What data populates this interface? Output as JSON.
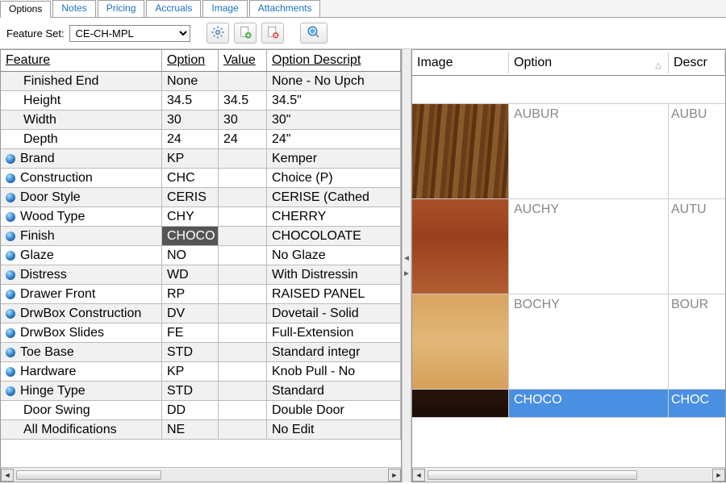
{
  "tabs": [
    "Options",
    "Notes",
    "Pricing",
    "Accruals",
    "Image",
    "Attachments"
  ],
  "activeTab": 0,
  "toolbar": {
    "featureSetLabel": "Feature Set:",
    "featureSetValue": "CE-CH-MPL"
  },
  "leftGrid": {
    "headers": {
      "feature": "Feature",
      "option": "Option",
      "value": "Value",
      "desc": "Option Descript"
    },
    "rows": [
      {
        "feature": "Finished End",
        "option": "None",
        "value": "",
        "desc": "None - No Upch",
        "indent": true,
        "globe": false
      },
      {
        "feature": "Height",
        "option": "34.5",
        "value": "34.5",
        "desc": "34.5\"",
        "indent": true,
        "globe": false
      },
      {
        "feature": "Width",
        "option": "30",
        "value": "30",
        "desc": "30\"",
        "indent": true,
        "globe": false
      },
      {
        "feature": "Depth",
        "option": "24",
        "value": "24",
        "desc": "24\"",
        "indent": true,
        "globe": false
      },
      {
        "feature": "Brand",
        "option": "KP",
        "value": "",
        "desc": "Kemper",
        "indent": false,
        "globe": true
      },
      {
        "feature": "Construction",
        "option": "CHC",
        "value": "",
        "desc": "Choice (P)",
        "indent": false,
        "globe": true
      },
      {
        "feature": "Door Style",
        "option": "CERIS",
        "value": "",
        "desc": "CERISE (Cathed",
        "indent": false,
        "globe": true
      },
      {
        "feature": "Wood Type",
        "option": "CHY",
        "value": "",
        "desc": "CHERRY",
        "indent": false,
        "globe": true
      },
      {
        "feature": "Finish",
        "option": "CHOCO",
        "value": "",
        "desc": "CHOCOLOATE",
        "indent": false,
        "globe": true,
        "optionSelected": true
      },
      {
        "feature": "Glaze",
        "option": "NO",
        "value": "",
        "desc": "No Glaze",
        "indent": false,
        "globe": true
      },
      {
        "feature": "Distress",
        "option": "WD",
        "value": "",
        "desc": "With Distressin",
        "indent": false,
        "globe": true
      },
      {
        "feature": "Drawer Front",
        "option": "RP",
        "value": "",
        "desc": "RAISED PANEL",
        "indent": false,
        "globe": true
      },
      {
        "feature": "DrwBox Construction",
        "option": "DV",
        "value": "",
        "desc": "Dovetail - Solid",
        "indent": false,
        "globe": true
      },
      {
        "feature": "DrwBox Slides",
        "option": "FE",
        "value": "",
        "desc": "Full-Extension",
        "indent": false,
        "globe": true
      },
      {
        "feature": "Toe Base",
        "option": "STD",
        "value": "",
        "desc": "Standard integr",
        "indent": false,
        "globe": true
      },
      {
        "feature": "Hardware",
        "option": "KP",
        "value": "",
        "desc": "Knob Pull - No",
        "indent": false,
        "globe": true
      },
      {
        "feature": "Hinge Type",
        "option": "STD",
        "value": "",
        "desc": "Standard",
        "indent": false,
        "globe": true
      },
      {
        "feature": "Door Swing",
        "option": "DD",
        "value": "",
        "desc": "Double Door",
        "indent": true,
        "globe": false
      },
      {
        "feature": "All Modifications",
        "option": "NE",
        "value": "",
        "desc": "No Edit",
        "indent": true,
        "globe": false
      }
    ]
  },
  "rightGrid": {
    "headers": {
      "image": "Image",
      "option": "Option",
      "desc": "Descr"
    },
    "rows": [
      {
        "option": "AUBUR",
        "desc": "AUBU",
        "swatch": "oak",
        "selected": false
      },
      {
        "option": "AUCHY",
        "desc": "AUTU",
        "swatch": "cherry",
        "selected": false
      },
      {
        "option": "BOCHY",
        "desc": "BOUR",
        "swatch": "maple",
        "selected": false
      },
      {
        "option": "CHOCO",
        "desc": "CHOC",
        "swatch": "choco",
        "selected": true
      }
    ]
  }
}
